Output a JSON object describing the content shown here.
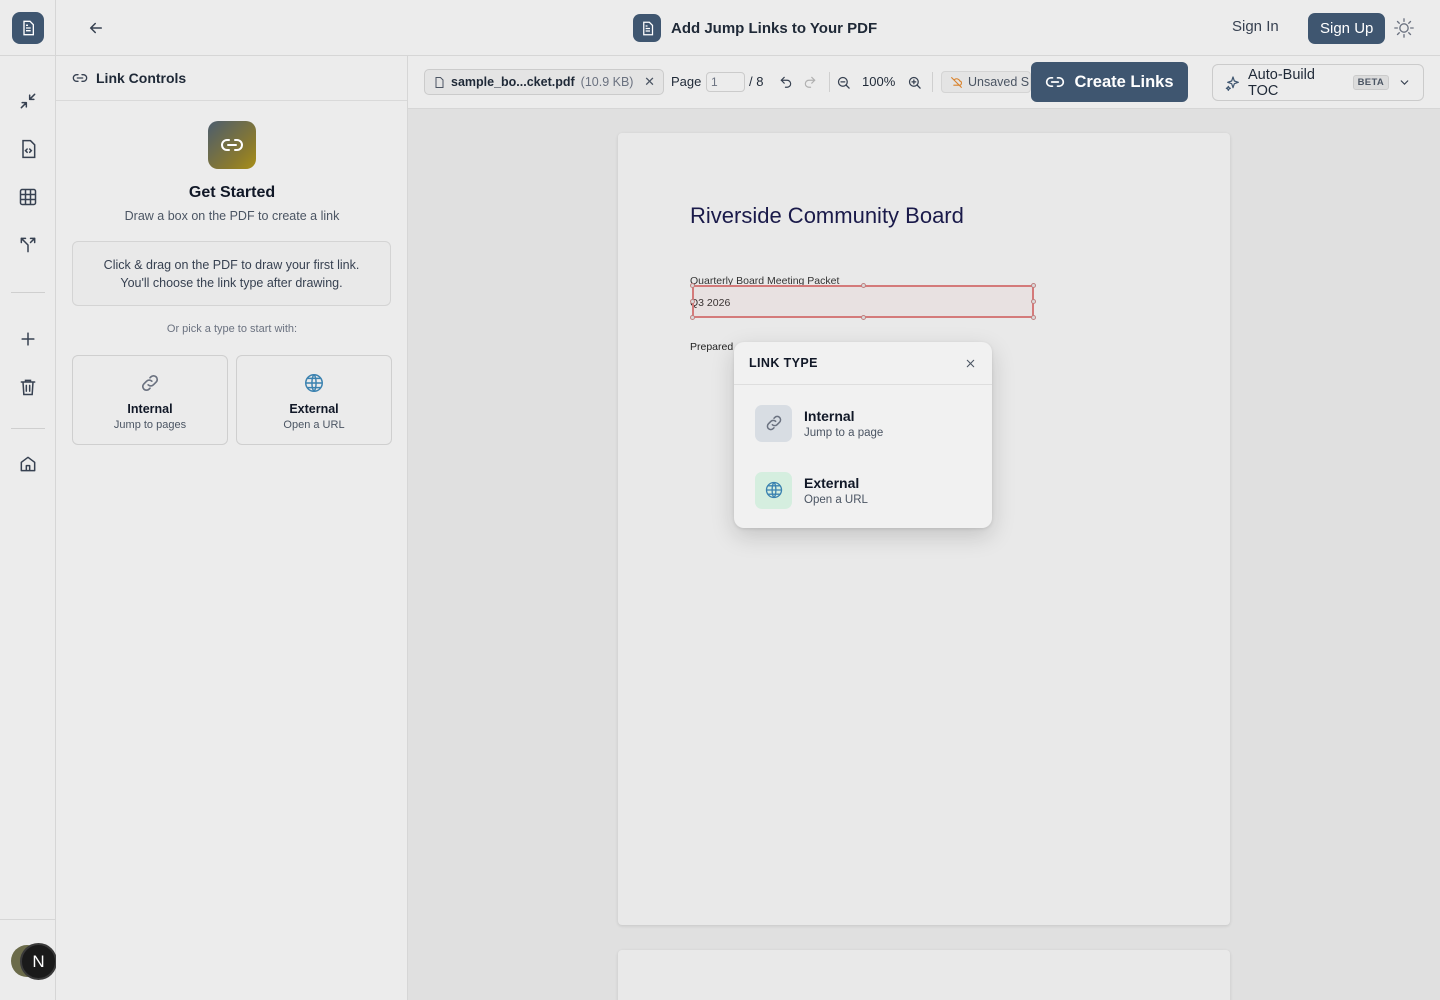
{
  "header": {
    "title": "Add Jump Links to Your PDF",
    "sign_in": "Sign In",
    "sign_up": "Sign Up"
  },
  "rail": {
    "avatar_initial": "N"
  },
  "panel": {
    "title": "Link Controls",
    "get_started_title": "Get Started",
    "get_started_sub": "Draw a box on the PDF to create a link",
    "hint_line1": "Click & drag on the PDF to draw your first link.",
    "hint_line2": "You'll choose the link type after drawing.",
    "pick_label": "Or pick a type to start with:",
    "internal": {
      "title": "Internal",
      "sub": "Jump to pages"
    },
    "external": {
      "title": "External",
      "sub": "Open a URL"
    }
  },
  "toolbar": {
    "file_name": "sample_bo...cket.pdf",
    "file_size": "(10.9 KB)",
    "page_label": "Page",
    "page_value": "1",
    "page_total": "/ 8",
    "zoom": "100%",
    "unsaved": "Unsaved S",
    "create_links": "Create Links",
    "auto_toc": "Auto-Build TOC",
    "beta": "BETA"
  },
  "pdf": {
    "title": "Riverside Community Board",
    "subtitle": "Quarterly Board Meeting Packet",
    "quarter": "Q3 2026",
    "prepared": "Prepared"
  },
  "popup": {
    "title": "LINK TYPE",
    "internal": {
      "title": "Internal",
      "sub": "Jump to a page"
    },
    "external": {
      "title": "External",
      "sub": "Open a URL"
    }
  },
  "colors": {
    "accent": "#3f5670",
    "link_box": "#d47a7a"
  }
}
